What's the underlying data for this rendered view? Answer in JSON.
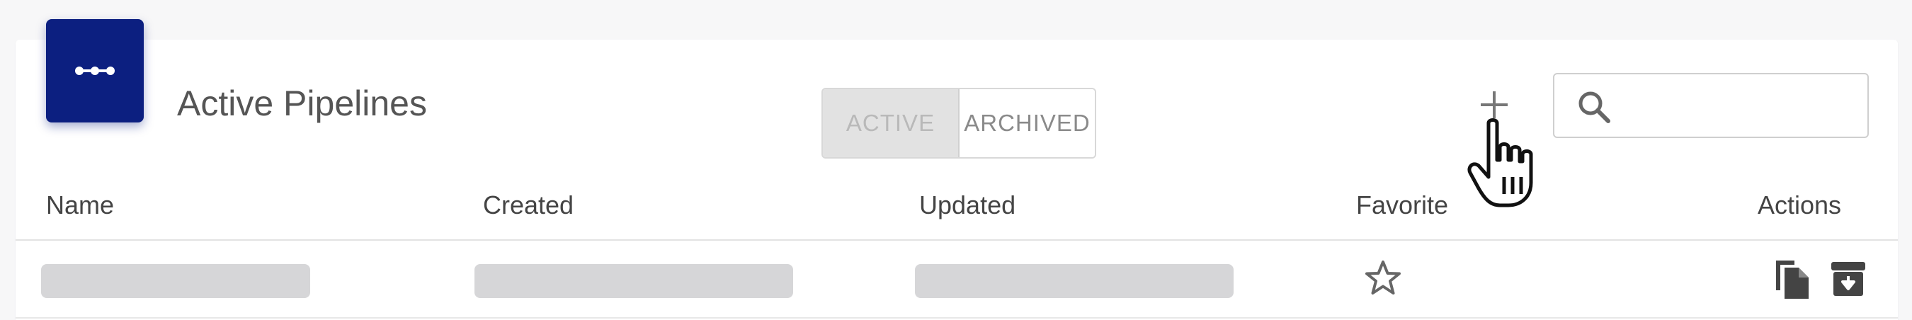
{
  "header": {
    "title": "Active Pipelines",
    "logo_icon": "pipeline-dots-icon",
    "brand_color": "#0c1f80"
  },
  "filter_toggle": {
    "options": [
      "ACTIVE",
      "ARCHIVED"
    ],
    "selected": "ACTIVE"
  },
  "toolbar": {
    "add_icon": "plus-icon",
    "search": {
      "icon": "search-icon",
      "value": "",
      "placeholder": ""
    }
  },
  "table": {
    "columns": [
      "Name",
      "Created",
      "Updated",
      "Favorite",
      "Actions"
    ],
    "rows": [
      {
        "name": "",
        "created": "",
        "updated": "",
        "favorite_icon": "star-outline-icon",
        "actions": [
          "copy-icon",
          "archive-icon"
        ]
      }
    ]
  }
}
